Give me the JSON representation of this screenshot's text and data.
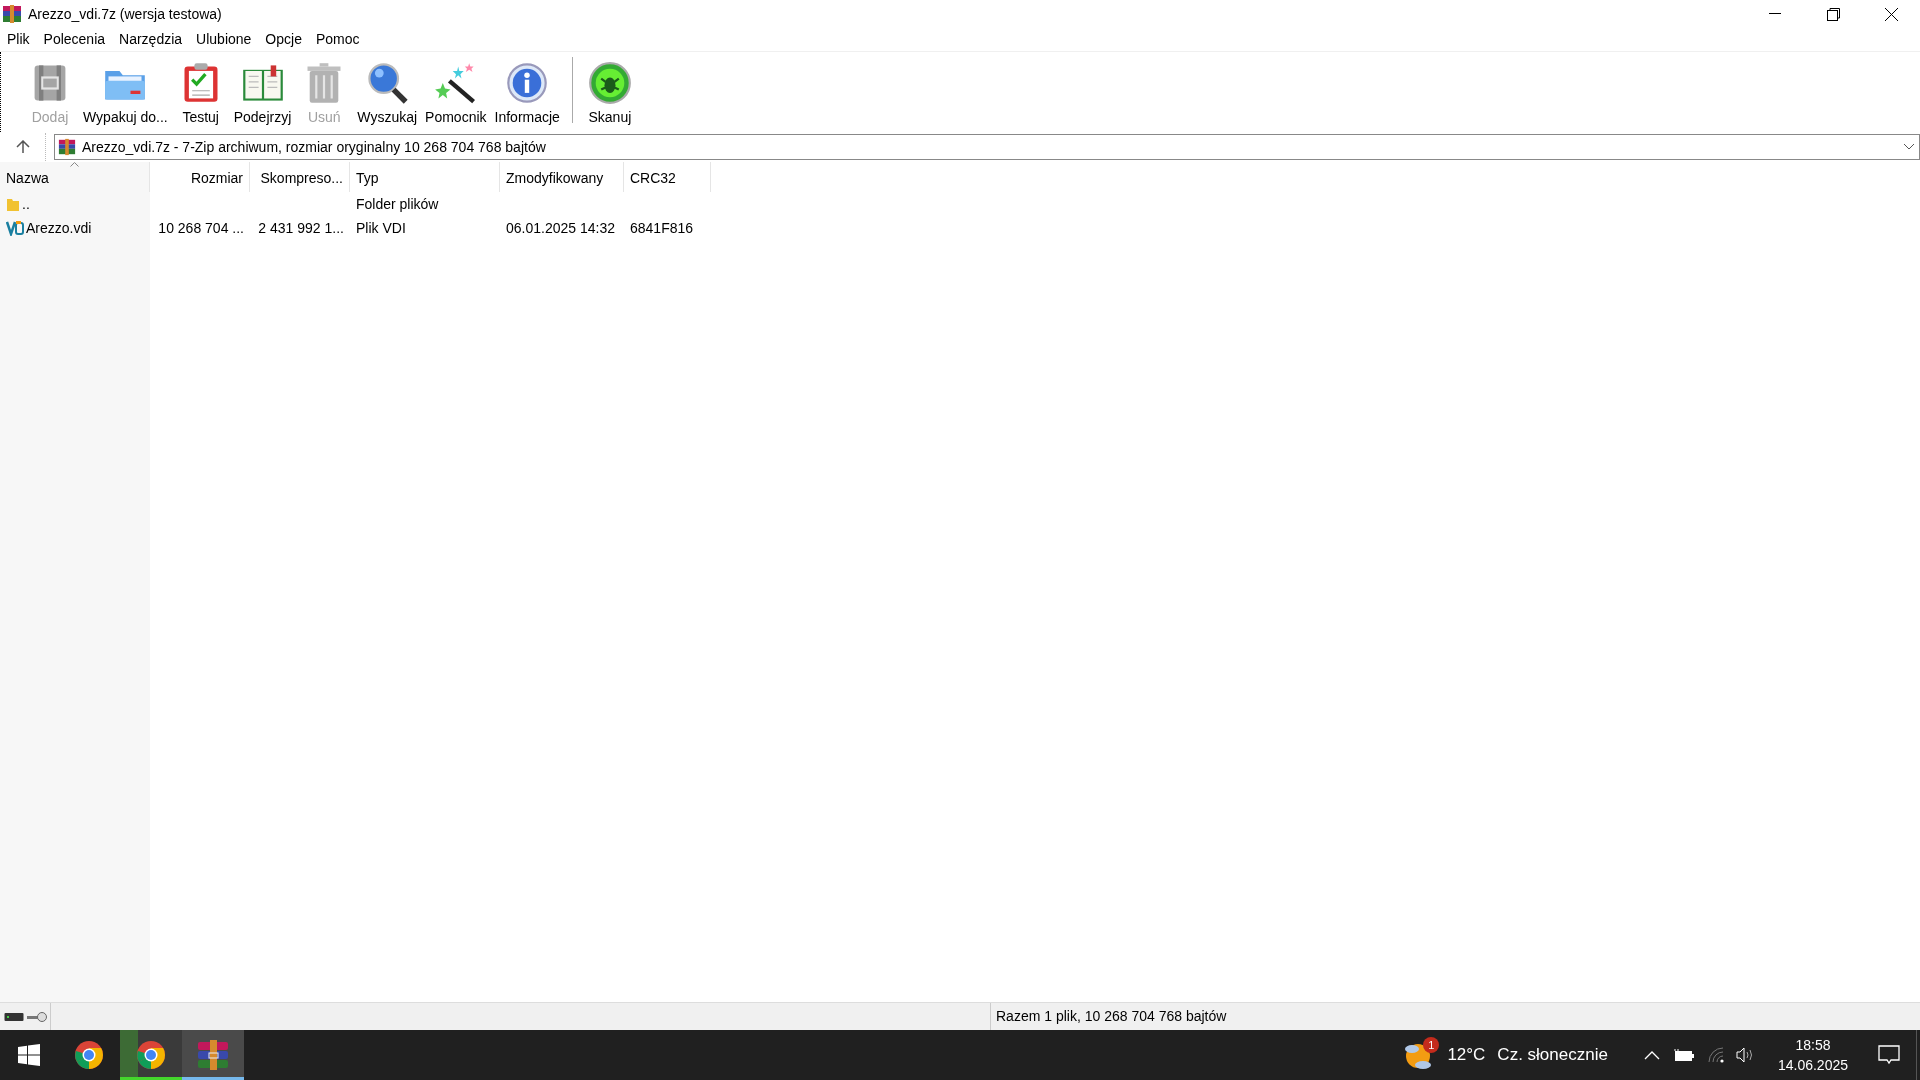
{
  "window": {
    "title": "Arezzo_vdi.7z (wersja testowa)"
  },
  "menu": [
    "Plik",
    "Polecenia",
    "Narzędzia",
    "Ulubione",
    "Opcje",
    "Pomoc"
  ],
  "toolbar": [
    {
      "kind": "add",
      "label": "Dodaj",
      "disabled": true
    },
    {
      "kind": "extract",
      "label": "Wypakuj do...",
      "disabled": false
    },
    {
      "kind": "test",
      "label": "Testuj",
      "disabled": false
    },
    {
      "kind": "view",
      "label": "Podejrzyj",
      "disabled": false
    },
    {
      "kind": "delete",
      "label": "Usuń",
      "disabled": true
    },
    {
      "kind": "find",
      "label": "Wyszukaj",
      "disabled": false
    },
    {
      "kind": "wizard",
      "label": "Pomocnik",
      "disabled": false
    },
    {
      "kind": "info",
      "label": "Informacje",
      "disabled": false
    },
    {
      "kind": "scan",
      "label": "Skanuj",
      "disabled": false
    }
  ],
  "address": {
    "value": "Arezzo_vdi.7z - 7-Zip archiwum, rozmiar oryginalny 10 268 704 768 bajtów"
  },
  "table": {
    "columns": [
      {
        "label": "Nazwa",
        "sorted": true
      },
      {
        "label": "Rozmiar",
        "sorted": false
      },
      {
        "label": "Skompreso...",
        "sorted": false
      },
      {
        "label": "Typ",
        "sorted": false
      },
      {
        "label": "Zmodyfikowany",
        "sorted": false
      },
      {
        "label": "CRC32",
        "sorted": false
      }
    ],
    "rows": [
      {
        "kind": "folder",
        "cells": [
          "..",
          "",
          "",
          "Folder plików",
          "",
          ""
        ]
      },
      {
        "kind": "vdi",
        "cells": [
          "Arezzo.vdi",
          "10 268 704 ...",
          "2 431 992 1...",
          "Plik VDI",
          "06.01.2025 14:32",
          "6841F816"
        ]
      }
    ]
  },
  "status_bar": {
    "text": "Razem 1 plik, 10 268 704 768 bajtów"
  },
  "taskbar": {
    "apps": [
      {
        "kind": "chrome",
        "running": false,
        "selected": false
      },
      {
        "kind": "chrome",
        "running": true,
        "selected": false
      },
      {
        "kind": "archiver",
        "running": false,
        "selected": true
      }
    ],
    "weather": {
      "badge": "1",
      "temperature": "12°C",
      "condition": "Cz. słonecznie"
    },
    "time": "18:58",
    "date": "14.06.2025"
  }
}
